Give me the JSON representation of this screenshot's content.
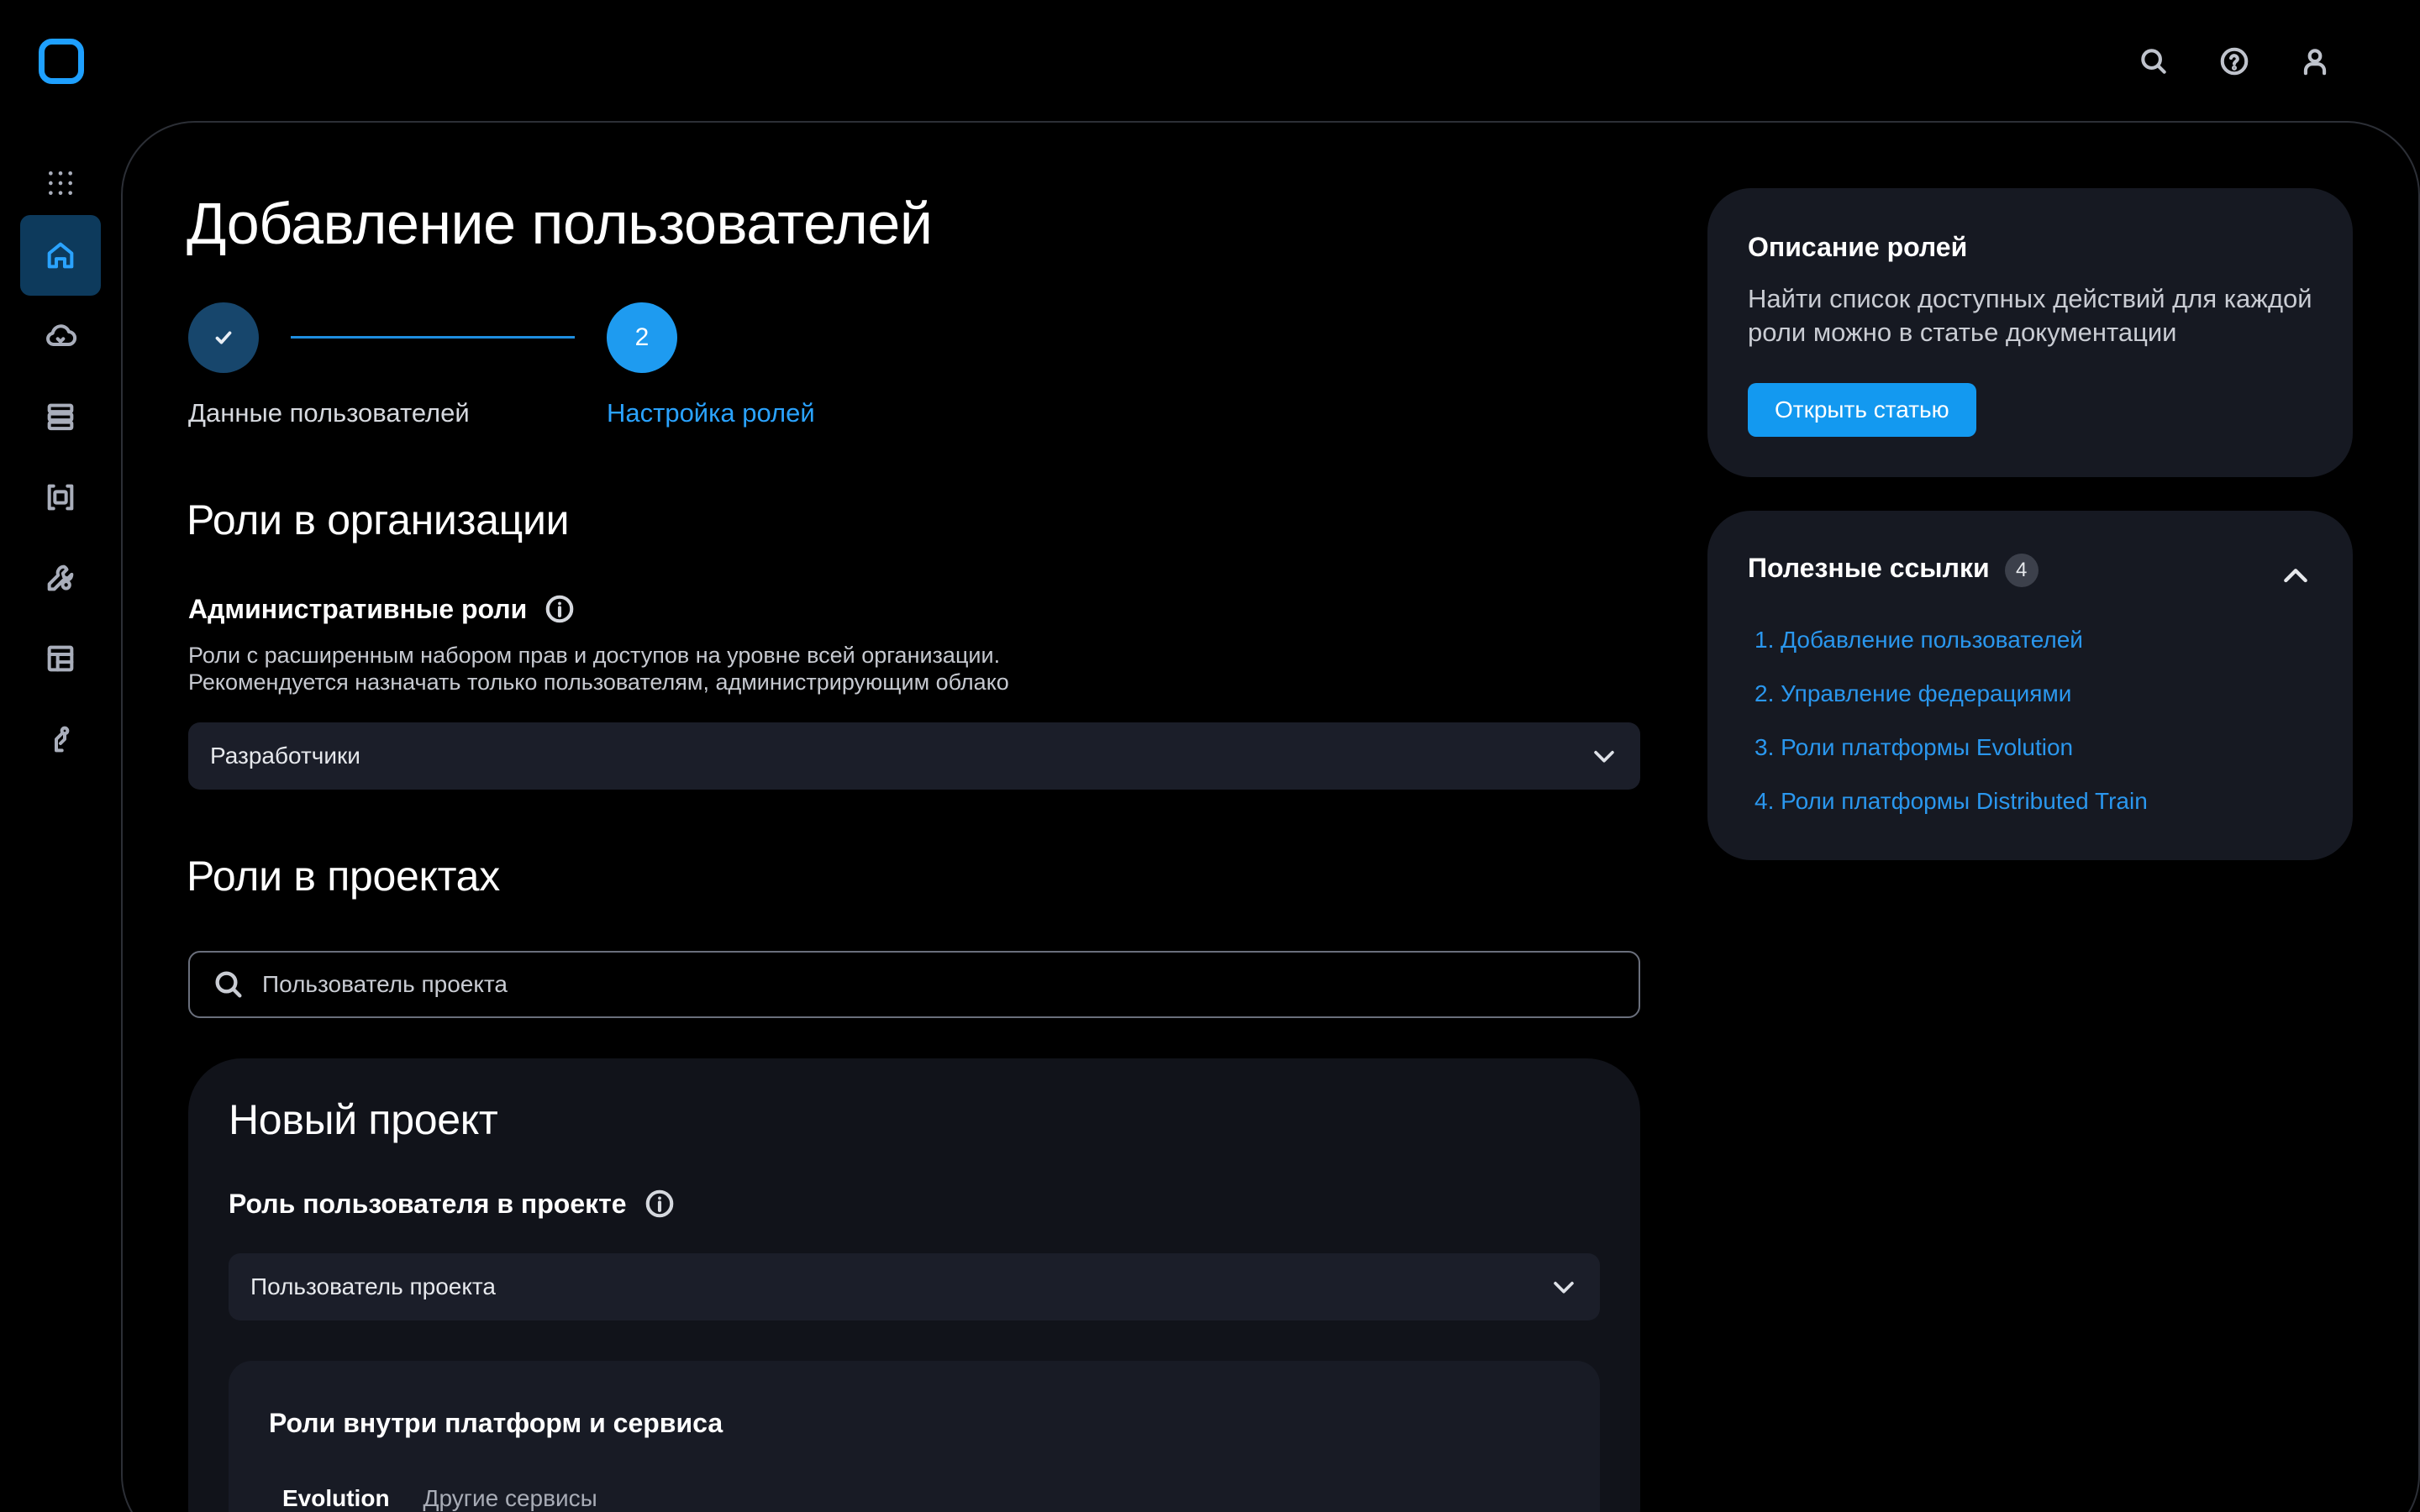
{
  "header": {
    "icons": [
      "search-icon",
      "help-icon",
      "user-icon"
    ]
  },
  "sidebar": {
    "items": [
      {
        "name": "apps-grid-icon",
        "active": false
      },
      {
        "name": "home-icon",
        "active": true
      },
      {
        "name": "cloud-icon",
        "active": false
      },
      {
        "name": "server-stack-icon",
        "active": false
      },
      {
        "name": "container-icon",
        "active": false
      },
      {
        "name": "tools-icon",
        "active": false
      },
      {
        "name": "layout-icon",
        "active": false
      },
      {
        "name": "robot-arm-icon",
        "active": false
      }
    ]
  },
  "page": {
    "title": "Добавление пользователей"
  },
  "stepper": {
    "step1_label": "Данные пользователей",
    "step2_number": "2",
    "step2_label": "Настройка ролей"
  },
  "org_roles": {
    "title": "Роли в организации",
    "admin_title": "Административные роли",
    "desc_line1": "Роли с расширенным набором прав и доступов на уровне всей организации.",
    "desc_line2": "Рекомендуется назначать только пользователям, администрирующим облако",
    "select_value": "Разработчики"
  },
  "project_roles": {
    "title": "Роли в проектах",
    "search_value": "Пользователь проекта"
  },
  "project_card": {
    "title": "Новый проект",
    "role_label": "Роль пользователя в проекте",
    "role_value": "Пользователь проекта",
    "inner_title": "Роли внутри платформ и сервиса",
    "tabs": [
      "Evolution",
      "Другие сервисы"
    ]
  },
  "roles_info": {
    "title": "Описание ролей",
    "text": "Найти список доступных действий для каждой роли можно в статье документации",
    "button": "Открыть статью"
  },
  "useful_links": {
    "title": "Полезные ссылки",
    "count": "4",
    "items": [
      "1. Добавление пользователей",
      "2. Управление федерациями",
      "3. Роли платформы Evolution",
      "4. Роли платформы Distributed Train"
    ]
  },
  "colors": {
    "accent": "#1e9bf0",
    "link": "#2a97ee",
    "background": "#000000",
    "card": "#161922"
  }
}
